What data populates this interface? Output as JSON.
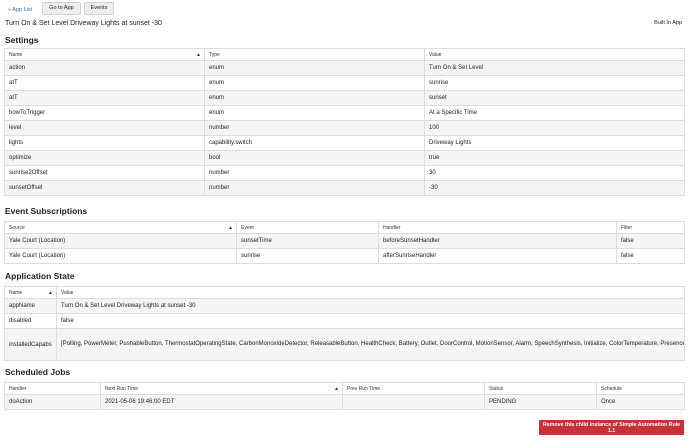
{
  "topbar": {
    "app_list_link": "« App List",
    "buttons": [
      "Go to App",
      "Events"
    ]
  },
  "page": {
    "title": "Turn On & Set Level Driveway Lights at sunset -30",
    "built_in": "Built In App"
  },
  "settings": {
    "section_title": "Settings",
    "headers": [
      "Name",
      "Type",
      "Value"
    ],
    "rows": [
      {
        "name": "action",
        "type": "enum",
        "value": "Turn On & Set Level",
        "link": false
      },
      {
        "name": "atT",
        "type": "enum",
        "value": "sunrise",
        "link": false
      },
      {
        "name": "atT",
        "type": "enum",
        "value": "sunset",
        "link": false
      },
      {
        "name": "howToTrigger",
        "type": "enum",
        "value": "At a Specific Time",
        "link": false
      },
      {
        "name": "level",
        "type": "number",
        "value": "100",
        "link": false
      },
      {
        "name": "lights",
        "type": "capability.switch",
        "value": "Driveway Lights",
        "link": true
      },
      {
        "name": "optimize",
        "type": "bool",
        "value": "true",
        "link": false
      },
      {
        "name": "sunrise2Offset",
        "type": "number",
        "value": "30",
        "link": false
      },
      {
        "name": "sunsetOffset",
        "type": "number",
        "value": "-30",
        "link": false
      }
    ]
  },
  "event_subscriptions": {
    "section_title": "Event Subscriptions",
    "headers": [
      "Source",
      "Event",
      "Handler",
      "Filter"
    ],
    "rows": [
      {
        "source": "Yale Court (Location)",
        "event": "sunsetTime",
        "handler": "beforeSunsetHandler",
        "filter": "false"
      },
      {
        "source": "Yale Court (Location)",
        "event": "sunrise",
        "handler": "afterSunriseHandler",
        "filter": "false"
      }
    ]
  },
  "application_state": {
    "section_title": "Application State",
    "headers": [
      "Name",
      "Value"
    ],
    "rows": [
      {
        "name": "appName",
        "value": "Turn On & Set Level Driveway Lights at sunset -30"
      },
      {
        "name": "disabled",
        "value": "false"
      },
      {
        "name": "installedCapabs",
        "value": "[Polling, PowerMeter, PushableButton, ThermostatOperatingState, CarbonMonoxideDetector, ReleasableButton, HealthCheck, Battery, Outlet, DoorControl, MotionSensor, Alarm, SpeechSynthesis, Initialize, ColorTemperature, PresenceSensor, SmokeDetector, Thermostat, Light, AccelerationSensor, Refresh, RelativeHumidityMeasurement, AudioVolume, TamperAlert, EnergyMeter, ThermostatSetpoint, MusicPlayer, ColorMode, TemperatureMeasurement, Momentary, GarageDoorControl, Notification, HoldableButton, SwitchLevel, WaterSensor, Tone, Switch, ChangeLevel, Configuration, Actuator, Sensor, ContactSensor, SamsungTV, ColorControl, DoubleTapableButton, PowerSource]"
      }
    ]
  },
  "scheduled_jobs": {
    "section_title": "Scheduled Jobs",
    "headers": [
      "Handler",
      "Next Run Time",
      "Prev Run Time",
      "Status",
      "Schedule"
    ],
    "rows": [
      {
        "handler": "doAction",
        "next": "2021-05-06 19:46:00 EDT",
        "prev": "",
        "status": "PENDING",
        "schedule": "Once"
      }
    ]
  },
  "remove_button": "Remove this child instance of Simple Automation Rule 1.1",
  "colors": {
    "link": "#1e6fb8",
    "danger": "#c8313a",
    "row_alt": "#f5f5f5"
  }
}
